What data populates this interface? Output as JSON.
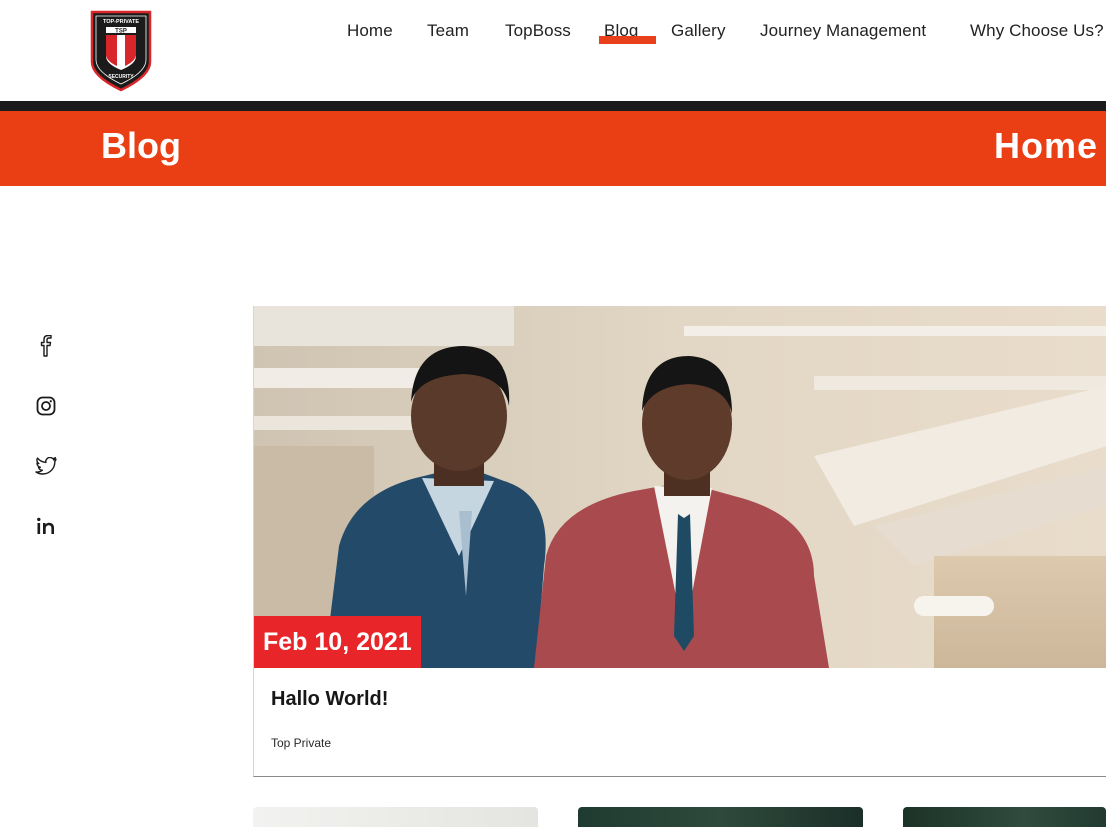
{
  "logo": {
    "top_text": "TOP-PRIVATE",
    "mid_text": "TSP",
    "bottom_text": "SECURITY",
    "colors": {
      "shield": "#1b1b1b",
      "border": "#d8262a",
      "stripe": "#d8262a"
    }
  },
  "nav": {
    "items": [
      {
        "label": "Home",
        "active": false
      },
      {
        "label": "Team",
        "active": false
      },
      {
        "label": "TopBoss",
        "active": false
      },
      {
        "label": "Blog",
        "active": true
      },
      {
        "label": "Gallery",
        "active": false
      },
      {
        "label": "Journey Management",
        "active": false
      },
      {
        "label": "Why Choose Us?",
        "active": false
      }
    ]
  },
  "banner": {
    "title": "Blog",
    "breadcrumb": "Home"
  },
  "social": [
    {
      "icon": "facebook-icon"
    },
    {
      "icon": "instagram-icon"
    },
    {
      "icon": "twitter-icon"
    },
    {
      "icon": "linkedin-icon"
    }
  ],
  "post": {
    "date": "Feb 10, 2021",
    "title": "Hallo World!",
    "author": "Top Private",
    "image": "two-men-in-suits-photo"
  },
  "colors": {
    "accent": "#ea3e14",
    "badge": "#e8262a",
    "dark": "#1b1b1b"
  }
}
